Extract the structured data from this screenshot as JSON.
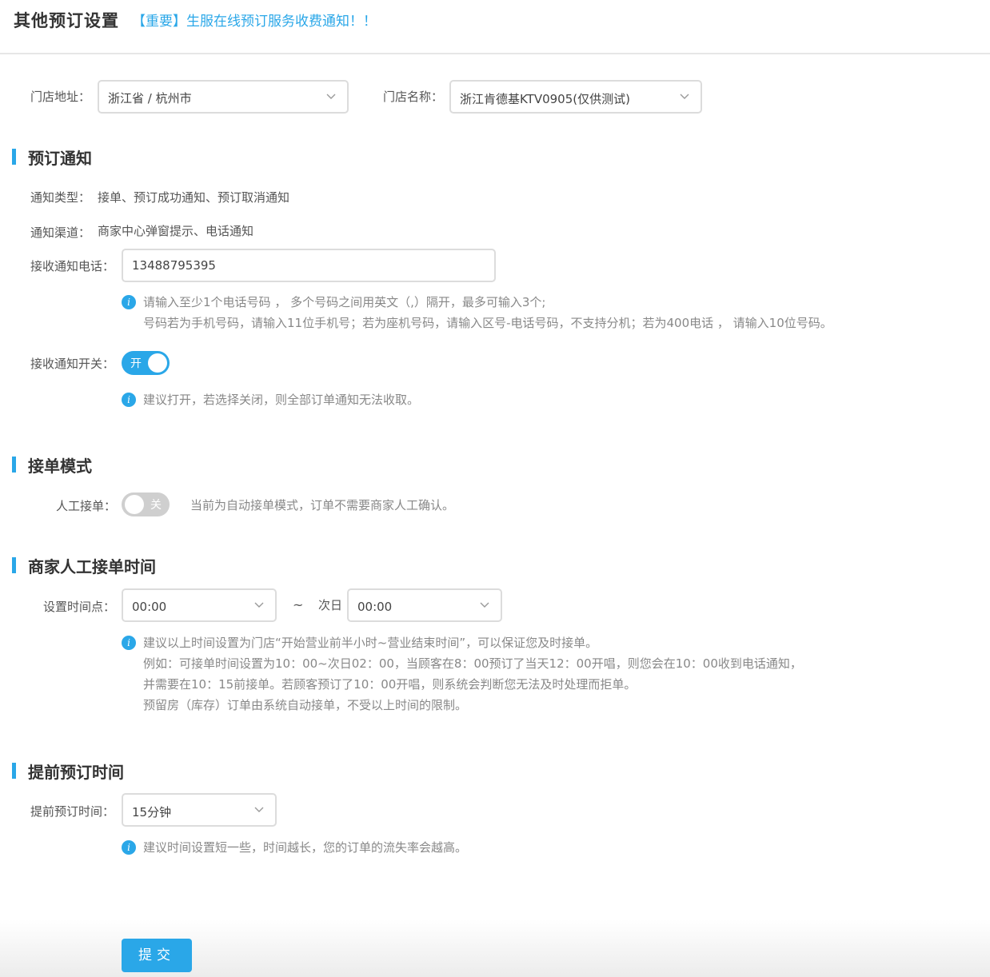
{
  "header": {
    "title": "其他预订设置",
    "notice_link": "【重要】生服在线预订服务收费通知！！"
  },
  "store": {
    "address_label": "门店地址：",
    "address_value": "浙江省 / 杭州市",
    "name_label": "门店名称：",
    "name_value": "浙江肯德基KTV0905(仅供测试)"
  },
  "notification": {
    "section_title": "预订通知",
    "type_label": "通知类型：",
    "type_value": "接单、预订成功通知、预订取消通知",
    "channel_label": "通知渠道：",
    "channel_value": "商家中心弹窗提示、电话通知",
    "phone_label": "接收通知电话：",
    "phone_value": "13488795395",
    "phone_tip_line1": "请输入至少1个电话号码 ， 多个号码之间用英文（,）隔开，最多可输入3个;",
    "phone_tip_line2": "号码若为手机号码，请输入11位手机号；若为座机号码，请输入区号-电话号码，不支持分机；若为400电话 ，  请输入10位号码。",
    "switch_label": "接收通知开关：",
    "switch_text": "开",
    "switch_on": true,
    "switch_tip": "建议打开，若选择关闭，则全部订单通知无法收取。"
  },
  "order_mode": {
    "section_title": "接单模式",
    "manual_label": "人工接单：",
    "manual_text": "关",
    "manual_on": false,
    "manual_hint": "当前为自动接单模式，订单不需要商家人工确认。"
  },
  "manual_time": {
    "section_title": "商家人工接单时间",
    "time_label": "设置时间点：",
    "start_value": "00:00",
    "separator": "~",
    "next_day_label": "次日",
    "end_value": "00:00",
    "tip_lines": [
      "建议以上时间设置为门店“开始营业前半小时~营业结束时间”，可以保证您及时接单。",
      "例如：可接单时间设置为10：00~次日02：00，当顾客在8：00预订了当天12：00开唱，则您会在10：00收到电话通知，",
      "并需要在10：15前接单。若顾客预订了10：00开唱，则系统会判断您无法及时处理而拒单。",
      "预留房（库存）订单由系统自动接单，不受以上时间的限制。"
    ]
  },
  "advance": {
    "section_title": "提前预订时间",
    "label": "提前预订时间：",
    "value": "15分钟",
    "tip": "建议时间设置短一些，时间越长，您的订单的流失率会越高。"
  },
  "submit_label": "提交",
  "icons": {
    "info": "info-icon",
    "chevron": "chevron-down-icon"
  },
  "colors": {
    "accent": "#2aa7e8",
    "toggle_off": "#cfcfcf"
  }
}
